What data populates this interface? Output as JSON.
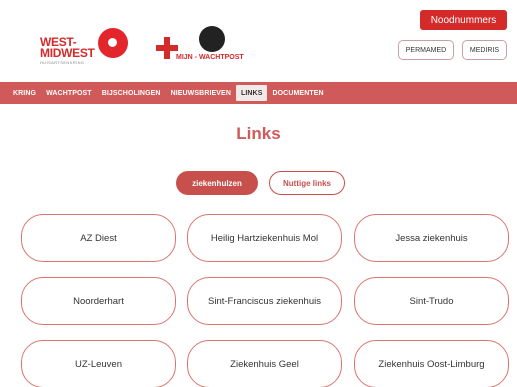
{
  "header": {
    "emergency_button": "Noodnummers",
    "logo_left": {
      "line1": "WEST-",
      "line2": "MIDWEST",
      "sub": "HUISARTSENKRING"
    },
    "logo_right": {
      "text": "MIJN - WACHTPOST"
    },
    "buttons": [
      "PERMAMED",
      "MEDIRIS"
    ]
  },
  "nav": {
    "items": [
      {
        "label": "KRING",
        "active": false
      },
      {
        "label": "WACHTPOST",
        "active": false
      },
      {
        "label": "BIJSCHOLINGEN",
        "active": false
      },
      {
        "label": "NIEUWSBRIEVEN",
        "active": false
      },
      {
        "label": "LINKS",
        "active": true
      },
      {
        "label": "DOCUMENTEN",
        "active": false
      }
    ]
  },
  "page": {
    "title": "Links",
    "tabs": [
      {
        "label": "ziekenhulzen",
        "active": true
      },
      {
        "label": "Nuttige links",
        "active": false
      }
    ],
    "hospitals": [
      "AZ Diest",
      "Heilig Hartziekenhuis Mol",
      "Jessa ziekenhuis",
      "Noorderhart",
      "Sint-Franciscus ziekenhuis",
      "Sint-Trudo",
      "UZ-Leuven",
      "Ziekenhuis Geel",
      "Ziekenhuis Oost-Limburg"
    ]
  },
  "colors": {
    "brand_red": "#d42a2a",
    "nav_bg": "#d05a5a",
    "card_border": "#d8766f"
  }
}
